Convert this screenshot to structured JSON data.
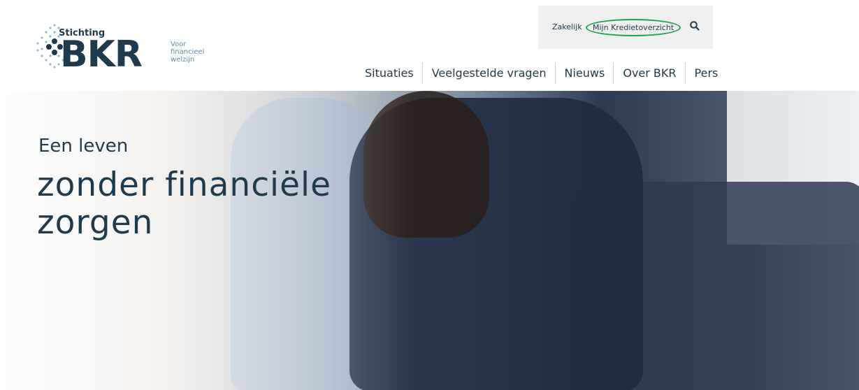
{
  "brand": {
    "org_label": "Stichting",
    "name": "BKR",
    "tagline_1": "Voor",
    "tagline_2": "financieel",
    "tagline_3": "welzijn"
  },
  "utility": {
    "zakelijk": "Zakelijk",
    "mijn": "Mijn Kredietoverzicht",
    "search_icon": "search-icon"
  },
  "nav": [
    {
      "label": "Situaties"
    },
    {
      "label": "Veelgestelde vragen"
    },
    {
      "label": "Nieuws"
    },
    {
      "label": "Over BKR"
    },
    {
      "label": "Pers"
    }
  ],
  "hero": {
    "kicker": "Een leven",
    "headline": "zonder financiële zorgen"
  },
  "colors": {
    "brand": "#1f3a4d",
    "accent": "#5a8fb0",
    "highlight": "#1aa24a",
    "utility_bg": "#efefef"
  }
}
